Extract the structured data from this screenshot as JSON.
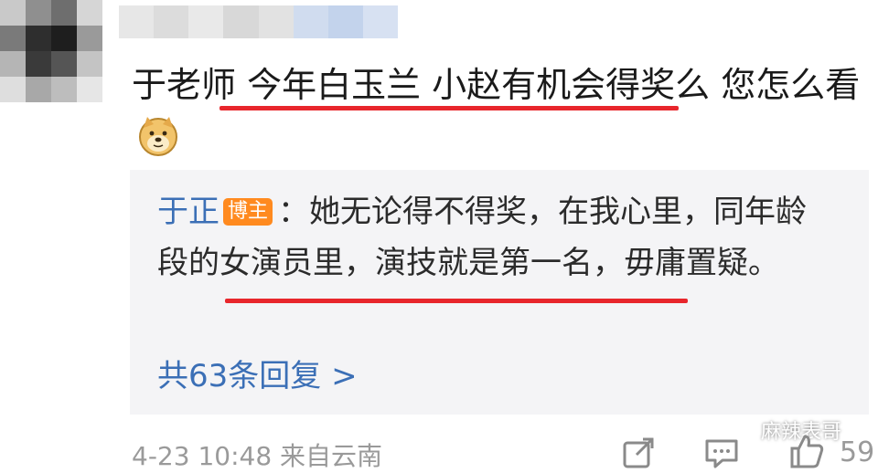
{
  "comment": {
    "text": "于老师 今年白玉兰 小赵有机会得奖么 您怎么看",
    "emoji_icon": "doge-icon"
  },
  "reply": {
    "author": "于正",
    "author_badge": "博主",
    "separator": "：",
    "text": "她无论得不得奖，在我心里，同年龄段的女演员里，演技就是第一名，毋庸置疑。"
  },
  "reply_count": "共63条回复 >",
  "meta": {
    "timestamp": "4-23 10:48",
    "location": "来自云南"
  },
  "actions": {
    "share_icon": "share-icon",
    "comment_icon": "comment-icon",
    "like_icon": "thumbs-up-icon",
    "like_count": "59"
  },
  "watermark": {
    "text": "麻辣表哥",
    "icon": "wechat-icon"
  },
  "colors": {
    "link_blue": "#3b6fb6",
    "badge_orange": "#ff8a1f",
    "underline_red": "#e8262c",
    "reply_bg": "#f4f4f6"
  }
}
